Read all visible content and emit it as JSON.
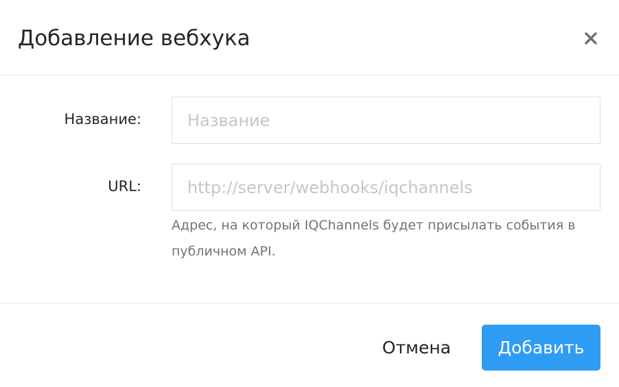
{
  "dialog": {
    "title": "Добавление вебхука",
    "close_icon": "close-icon"
  },
  "form": {
    "name": {
      "label": "Название:",
      "value": "",
      "placeholder": "Название"
    },
    "url": {
      "label": "URL:",
      "value": "",
      "placeholder": "http://server/webhooks/iqchannels",
      "help": "Адрес, на который IQChannels будет присылать события в публичном API."
    }
  },
  "footer": {
    "cancel_label": "Отмена",
    "submit_label": "Добавить"
  },
  "colors": {
    "primary": "#2f9cf4",
    "text": "#212529",
    "muted": "#6c757d",
    "placeholder": "#c2c6cb",
    "border": "#dcdfe3"
  }
}
